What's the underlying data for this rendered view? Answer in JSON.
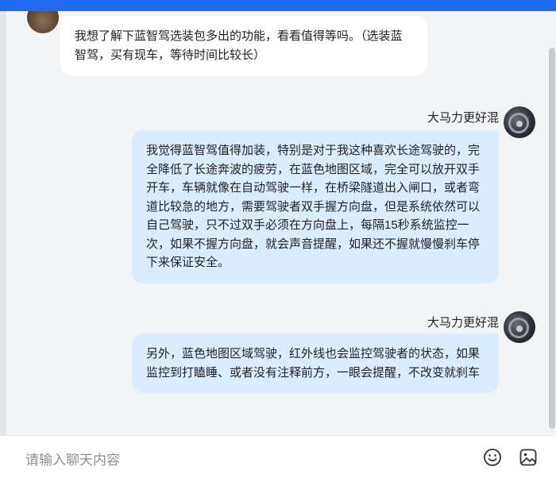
{
  "messages": [
    {
      "direction": "incoming",
      "text": "我想了解下蓝智驾选装包多出的功能，看看值得等吗。（选装蓝智驾，买有现车，等待时间比较长）"
    },
    {
      "direction": "outgoing",
      "sender": "大马力更好混",
      "text": "我觉得蓝智驾值得加装，特别是对于我这种喜欢长途驾驶的，完全降低了长途奔波的疲劳，在蓝色地图区域，完全可以放开双手开车，车辆就像在自动驾驶一样，在桥梁隧道出入闸口，或者弯道比较急的地方，需要驾驶者双手握方向盘，但是系统依然可以自己驾驶，只不过双手必须在方向盘上，每隔15秒系统监控一次，如果不握方向盘，就会声音提醒，如果还不握就慢慢刹车停下来保证安全。"
    },
    {
      "direction": "outgoing",
      "sender": "大马力更好混",
      "text": "另外，蓝色地图区域驾驶，红外线也会监控驾驶者的状态，如果监控到打瞌睡、或者没有注释前方，一眼会提醒，不改变就刹车"
    }
  ],
  "input": {
    "placeholder": "请输入聊天内容"
  },
  "icons": {
    "emoji": "smile-icon",
    "image": "image-icon"
  },
  "colors": {
    "top_bar": "#1f6af0",
    "incoming_bubble": "#ffffff",
    "outgoing_bubble": "#dcecff"
  }
}
